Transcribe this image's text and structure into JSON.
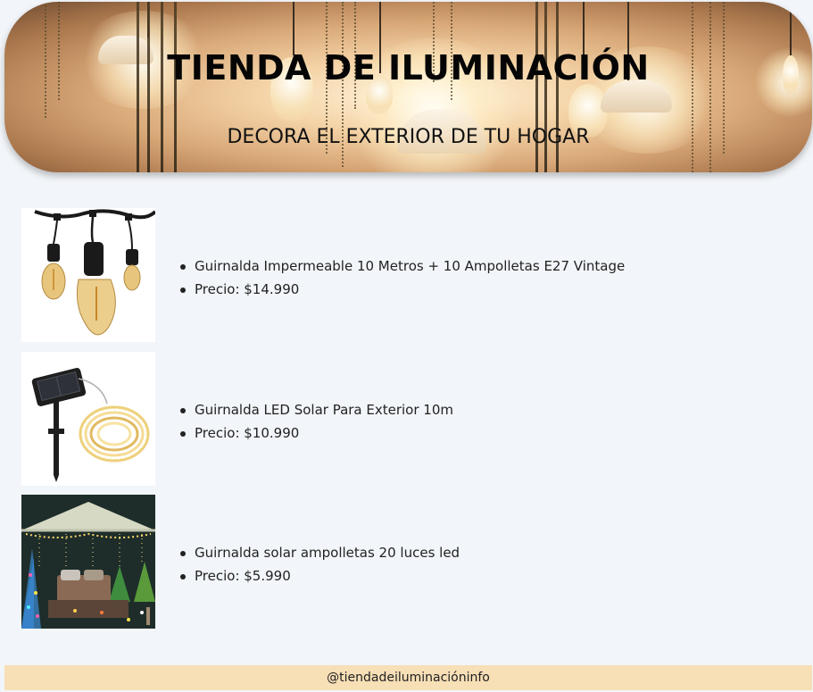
{
  "header": {
    "title": "TIENDA DE ILUMINACIÓN",
    "subtitle": "DECORA EL EXTERIOR DE TU HOGAR"
  },
  "products": [
    {
      "name": "Guirnalda Impermeable 10 Metros + 10 Ampolletas E27 Vintage",
      "price": "Precio: $14.990",
      "image_icon": "vintage-bulb-string-lights"
    },
    {
      "name": "Guirnalda LED Solar Para Exterior 10m",
      "price": "Precio: $10.990",
      "image_icon": "solar-led-fairy-lights"
    },
    {
      "name": "Guirnalda solar ampolletas 20 luces led",
      "price": "Precio: $5.990",
      "image_icon": "patio-garden-lights"
    }
  ],
  "footer": {
    "handle": "@tiendadeiluminacióninfo"
  },
  "colors": {
    "background": "#f2f5f9",
    "footer": "#f7dfb6",
    "hero_warm": "#f4d3a6"
  }
}
